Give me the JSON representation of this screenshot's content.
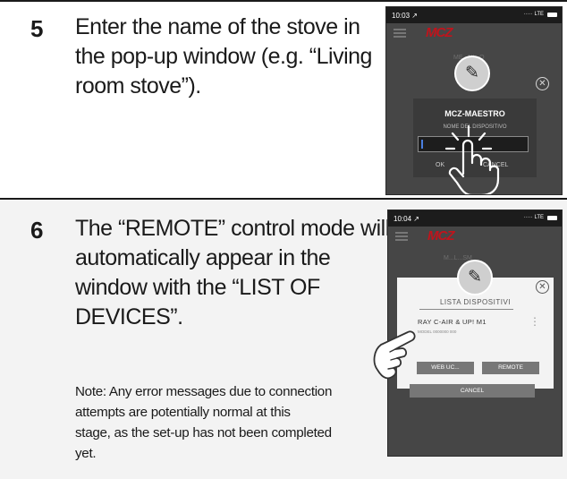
{
  "steps": [
    {
      "number": "5",
      "text_lines": [
        "Enter the name of the stove in",
        "the pop-up window (e.g. “Living",
        "room stove”)."
      ],
      "phone": {
        "time": "10:03 ↗",
        "signal": "····· LTE",
        "logo": "MCZ",
        "bg_text": "ME...NI...O",
        "dialog_title": "MCZ-MAESTRO",
        "dialog_subtitle": "NOME DEL DISPOSITIVO",
        "ok_label": "OK",
        "cancel_label": "CANCEL",
        "icons": [
          "menu-icon",
          "pencil-icon",
          "close-circle-icon",
          "hand-tap-icon"
        ]
      }
    },
    {
      "number": "6",
      "text_lines": [
        "The “REMOTE” control mode will",
        "automatically appear in the",
        "window with the “LIST OF",
        "DEVICES”."
      ],
      "note_lines": [
        "Note: Any error messages due to connection",
        "attempts are potentially normal at this",
        "stage, as the set-up has not been completed",
        "yet."
      ],
      "phone": {
        "time": "10:04 ↗",
        "signal": "····· LTE",
        "logo": "MCZ",
        "bg_text": "M...L...SM",
        "list_title": "LISTA DISPOSITIVI",
        "device_name": "RAY C-AIR & UP! M1",
        "device_sub": "MODEL 0000000 000",
        "left_button": "WEB UC...",
        "right_button": "REMOTE",
        "bottom_button": "CANCEL",
        "icons": [
          "menu-icon",
          "pencil-icon",
          "close-circle-icon",
          "more-vertical-icon",
          "hand-pointer-icon"
        ]
      }
    }
  ],
  "colors": {
    "accent": "#c0141c",
    "phone_bg": "#464646",
    "text": "#1a1a1a"
  }
}
